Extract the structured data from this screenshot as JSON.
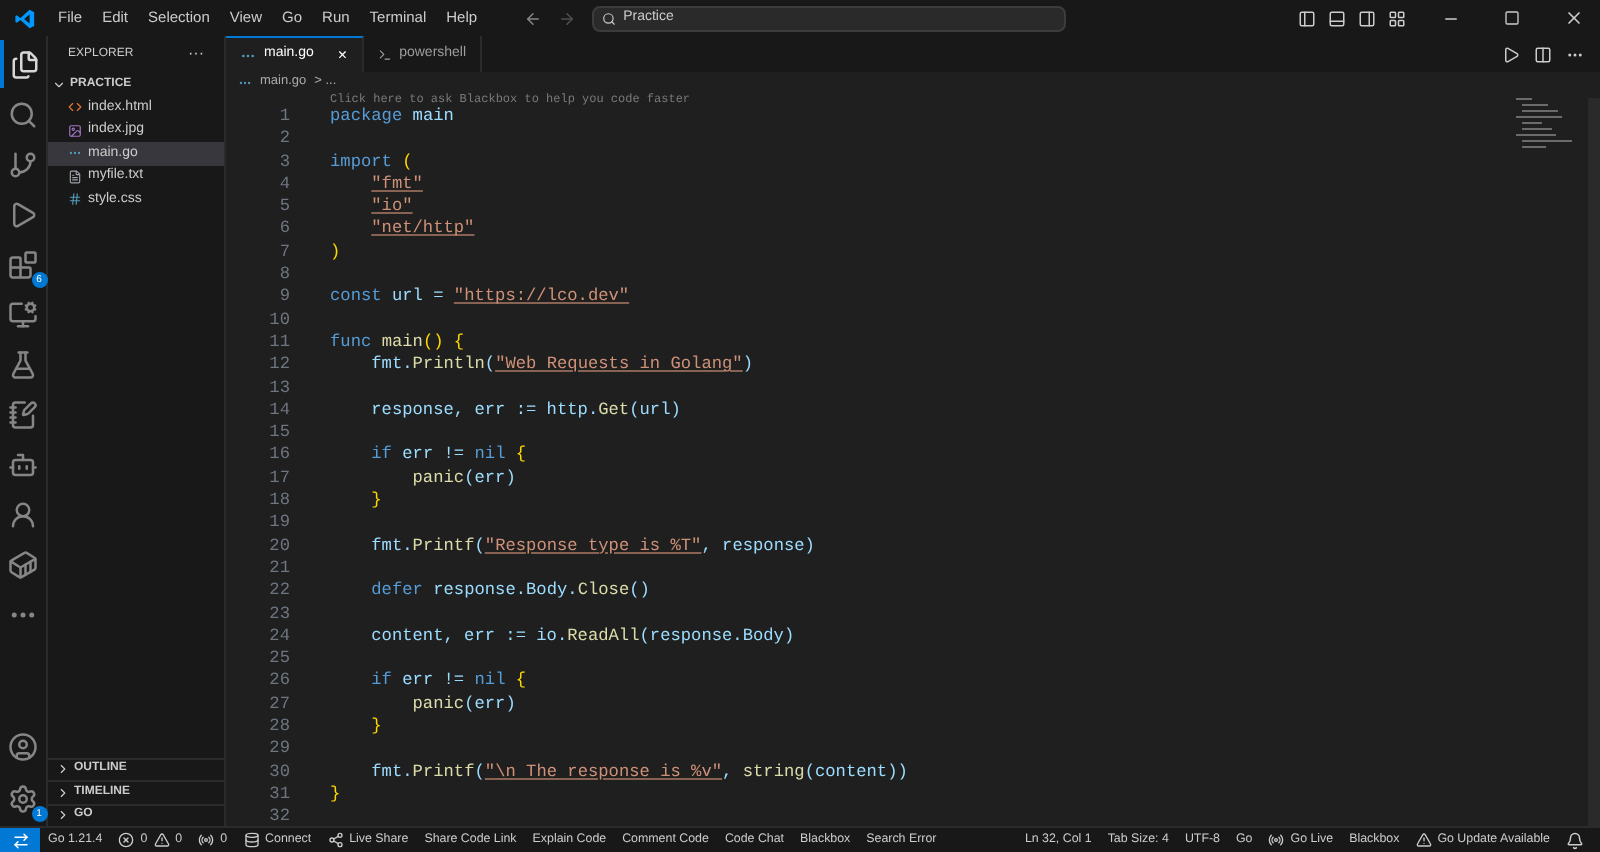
{
  "menu": [
    "File",
    "Edit",
    "Selection",
    "View",
    "Go",
    "Run",
    "Terminal",
    "Help"
  ],
  "search": {
    "value": "Practice"
  },
  "activity": [
    {
      "kind": "files",
      "selected": true
    },
    {
      "kind": "search",
      "selected": false
    },
    {
      "kind": "git",
      "selected": false
    },
    {
      "kind": "run",
      "selected": false
    },
    {
      "kind": "extensions",
      "selected": false,
      "badge": "6"
    },
    {
      "kind": "remote",
      "selected": false
    },
    {
      "kind": "testing",
      "selected": false
    },
    {
      "kind": "notes",
      "selected": false
    },
    {
      "kind": "bot",
      "selected": false
    },
    {
      "kind": "person",
      "selected": false
    },
    {
      "kind": "docker",
      "selected": false
    },
    {
      "kind": "more",
      "selected": false
    }
  ],
  "activity_bottom": [
    {
      "kind": "account"
    },
    {
      "kind": "settings",
      "badge": "1"
    }
  ],
  "sidebar": {
    "title": "EXPLORER",
    "more": "···",
    "folder": "PRACTICE",
    "files": [
      {
        "name": "index.html",
        "kind": "html",
        "selected": false
      },
      {
        "name": "index.jpg",
        "kind": "image",
        "selected": false
      },
      {
        "name": "main.go",
        "kind": "go",
        "selected": true
      },
      {
        "name": "myfile.txt",
        "kind": "text",
        "selected": false
      },
      {
        "name": "style.css",
        "kind": "css",
        "selected": false
      }
    ],
    "sections": [
      "OUTLINE",
      "TIMELINE",
      "GO"
    ]
  },
  "tabs": [
    {
      "label": "main.go",
      "kind": "go",
      "selected": true,
      "close": "×"
    },
    {
      "label": "powershell",
      "kind": "terminal",
      "selected": false
    }
  ],
  "breadcrumb": {
    "file": "main.go",
    "rest": "> ..."
  },
  "hint": "Click here to ask Blackbox to help you code faster",
  "code": [
    {
      "n": "1",
      "tokens": [
        {
          "kind": "kw",
          "t": "package"
        },
        {
          "kind": "pl",
          "t": " main"
        }
      ]
    },
    {
      "n": "2"
    },
    {
      "n": "3",
      "tokens": [
        {
          "kind": "kw",
          "t": "import"
        },
        {
          "kind": "br",
          "t": " ("
        }
      ]
    },
    {
      "n": "4",
      "tokens": [
        {
          "kind": "str",
          "t": "    \"fmt\""
        }
      ]
    },
    {
      "n": "5",
      "tokens": [
        {
          "kind": "str",
          "t": "    \"io\""
        }
      ]
    },
    {
      "n": "6",
      "tokens": [
        {
          "kind": "str",
          "t": "    \"net/http\""
        }
      ]
    },
    {
      "n": "7",
      "tokens": [
        {
          "kind": "br",
          "t": ")"
        }
      ]
    },
    {
      "n": "8"
    },
    {
      "n": "9",
      "tokens": [
        {
          "kind": "kw",
          "t": "const"
        },
        {
          "kind": "pl",
          "t": " url = "
        },
        {
          "kind": "str",
          "t": "\"https://lco.dev\""
        }
      ]
    },
    {
      "n": "10"
    },
    {
      "n": "11",
      "tokens": [
        {
          "kind": "kw",
          "t": "func"
        },
        {
          "kind": "fn",
          "t": " main"
        },
        {
          "kind": "br",
          "t": "() {"
        }
      ]
    },
    {
      "n": "12",
      "tokens": [
        {
          "kind": "pl",
          "t": "    fmt."
        },
        {
          "kind": "fn",
          "t": "Println"
        },
        {
          "kind": "pl",
          "t": "("
        },
        {
          "kind": "str",
          "t": "\"Web Requests in Golang\""
        },
        {
          "kind": "pl",
          "t": ")"
        }
      ]
    },
    {
      "n": "13"
    },
    {
      "n": "14",
      "tokens": [
        {
          "kind": "pl",
          "t": "    response, err := http."
        },
        {
          "kind": "fn",
          "t": "Get"
        },
        {
          "kind": "pl",
          "t": "(url)"
        }
      ]
    },
    {
      "n": "15"
    },
    {
      "n": "16",
      "tokens": [
        {
          "kind": "kw",
          "t": "    if"
        },
        {
          "kind": "pl",
          "t": " err != "
        },
        {
          "kind": "kw",
          "t": "nil"
        },
        {
          "kind": "br",
          "t": " {"
        }
      ]
    },
    {
      "n": "17",
      "tokens": [
        {
          "kind": "fn",
          "t": "        panic"
        },
        {
          "kind": "pl",
          "t": "(err)"
        }
      ]
    },
    {
      "n": "18",
      "tokens": [
        {
          "kind": "br",
          "t": "    }"
        }
      ]
    },
    {
      "n": "19"
    },
    {
      "n": "20",
      "tokens": [
        {
          "kind": "pl",
          "t": "    fmt."
        },
        {
          "kind": "fn",
          "t": "Printf"
        },
        {
          "kind": "pl",
          "t": "("
        },
        {
          "kind": "str",
          "t": "\"Response type is %T\""
        },
        {
          "kind": "pl",
          "t": ", response)"
        }
      ]
    },
    {
      "n": "21"
    },
    {
      "n": "22",
      "tokens": [
        {
          "kind": "kw",
          "t": "    defer"
        },
        {
          "kind": "pl",
          "t": " response.Body."
        },
        {
          "kind": "fn",
          "t": "Close"
        },
        {
          "kind": "pl",
          "t": "()"
        }
      ]
    },
    {
      "n": "23"
    },
    {
      "n": "24",
      "tokens": [
        {
          "kind": "pl",
          "t": "    content, err := io."
        },
        {
          "kind": "fn",
          "t": "ReadAll"
        },
        {
          "kind": "pl",
          "t": "(response.Body)"
        }
      ]
    },
    {
      "n": "25"
    },
    {
      "n": "26",
      "tokens": [
        {
          "kind": "kw",
          "t": "    if"
        },
        {
          "kind": "pl",
          "t": " err != "
        },
        {
          "kind": "kw",
          "t": "nil"
        },
        {
          "kind": "br",
          "t": " {"
        }
      ]
    },
    {
      "n": "27",
      "tokens": [
        {
          "kind": "fn",
          "t": "        panic"
        },
        {
          "kind": "pl",
          "t": "(err)"
        }
      ]
    },
    {
      "n": "28",
      "tokens": [
        {
          "kind": "br",
          "t": "    }"
        }
      ]
    },
    {
      "n": "29"
    },
    {
      "n": "30",
      "tokens": [
        {
          "kind": "pl",
          "t": "    fmt."
        },
        {
          "kind": "fn",
          "t": "Printf"
        },
        {
          "kind": "pl",
          "t": "("
        },
        {
          "kind": "str",
          "t": "\"\\n The response is %v\""
        },
        {
          "kind": "pl",
          "t": ", "
        },
        {
          "kind": "fn",
          "t": "string"
        },
        {
          "kind": "pl",
          "t": "(content))"
        }
      ]
    },
    {
      "n": "31",
      "tokens": [
        {
          "kind": "br",
          "t": "}"
        }
      ]
    },
    {
      "n": "32"
    }
  ],
  "status_left": [
    {
      "kind": "remote"
    },
    {
      "kind": "text",
      "label": "Go 1.21.4"
    },
    {
      "kind": "problems",
      "errors": "0",
      "warnings": "0"
    },
    {
      "kind": "ports",
      "label": "0"
    },
    {
      "kind": "connect",
      "label": "Connect"
    },
    {
      "kind": "share",
      "label": "Live Share"
    },
    {
      "kind": "text",
      "label": "Share Code Link"
    },
    {
      "kind": "text",
      "label": "Explain Code"
    },
    {
      "kind": "text",
      "label": "Comment Code"
    },
    {
      "kind": "text",
      "label": "Code Chat"
    },
    {
      "kind": "text",
      "label": "Blackbox"
    },
    {
      "kind": "text",
      "label": "Search Error"
    }
  ],
  "status_right": [
    {
      "kind": "text",
      "label": "Ln 32, Col 1"
    },
    {
      "kind": "text",
      "label": "Tab Size: 4"
    },
    {
      "kind": "text",
      "label": "UTF-8"
    },
    {
      "kind": "text",
      "label": "Go"
    },
    {
      "kind": "live",
      "label": "Go Live"
    },
    {
      "kind": "text",
      "label": "Blackbox"
    },
    {
      "kind": "warn",
      "label": "Go Update Available"
    },
    {
      "kind": "bell"
    }
  ]
}
